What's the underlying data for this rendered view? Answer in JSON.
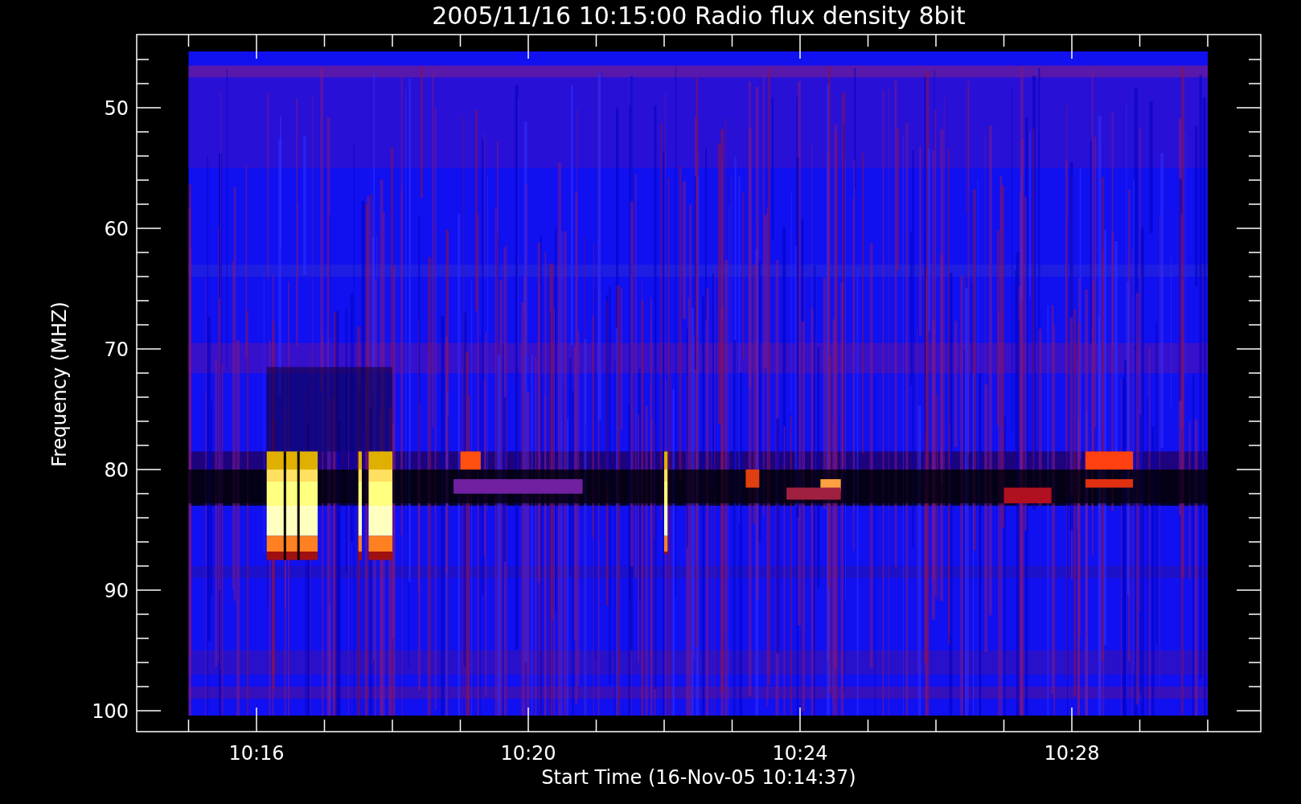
{
  "plot": {
    "title": "2005/11/16 10:15:00 Radio flux density 8bit",
    "ylabel": "Frequency (MHZ)",
    "xlabel": "Start Time (16-Nov-05 10:14:37)",
    "ytick_labels": [
      "50",
      "60",
      "70",
      "80",
      "90",
      "100"
    ],
    "xtick_labels": [
      "10:16",
      "10:20",
      "10:24",
      "10:28"
    ]
  }
}
